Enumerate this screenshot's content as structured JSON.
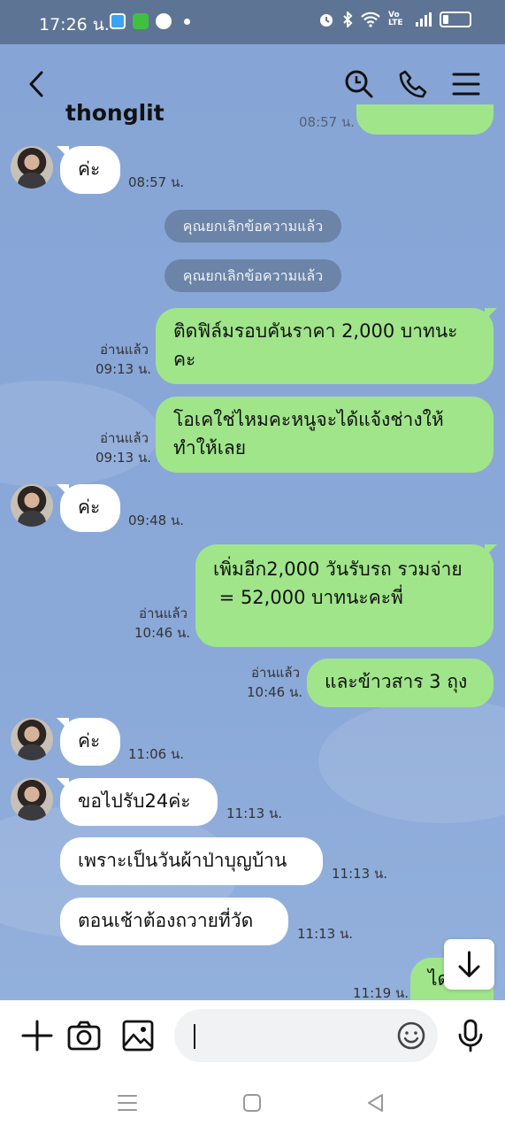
{
  "status_bar": {
    "time": "17:26 น.",
    "network_label": "Vo LTE"
  },
  "header": {
    "title": "thonglit"
  },
  "messages": [
    {
      "ts": "08:57 น."
    },
    {
      "text": "ค่ะ",
      "ts": "08:57 น."
    },
    {
      "text": "คุณยกเลิกข้อความแล้ว"
    },
    {
      "text": "คุณยกเลิกข้อความแล้ว"
    },
    {
      "line1": "ติดฟิล์มรอบคันราคา 2,000 บาทนะ",
      "line2": "คะ",
      "read": "อ่านแล้ว",
      "ts": "09:13 น."
    },
    {
      "line1": "โอเคใช่ไหมคะหนูจะได้แจ้งช่างให้",
      "line2": "ทำให้เลย",
      "read": "อ่านแล้ว",
      "ts": "09:13 น."
    },
    {
      "text": "ค่ะ",
      "ts": "09:48 น."
    },
    {
      "line1": "เพิ่มอีก2,000 วันรับรถ รวมจ่าย",
      "line2": " = 52,000 บาทนะคะพี่",
      "read": "อ่านแล้ว",
      "ts": "10:46 น."
    },
    {
      "text": "และข้าวสาร 3 ถุง",
      "read": "อ่านแล้ว",
      "ts": "10:46 น."
    },
    {
      "text": "ค่ะ",
      "ts": "11:06 น."
    },
    {
      "text": "ขอไปรับ24ค่ะ",
      "ts": "11:13 น."
    },
    {
      "text": "เพราะเป็นวันผ้าป่าบุญบ้าน",
      "ts": "11:13 น."
    },
    {
      "text": "ตอนเช้าต้องถวายที่วัด",
      "ts": "11:13 น."
    },
    {
      "text": "ได",
      "ts": "11:19 น."
    }
  ],
  "input": {
    "placeholder": "",
    "value": ""
  },
  "colors": {
    "chat_bg": "#8aa9d8",
    "outgoing_bubble": "#a0e58a",
    "incoming_bubble": "#ffffff",
    "status_bar": "#5e7494",
    "system_pill": "#6b84a8"
  }
}
